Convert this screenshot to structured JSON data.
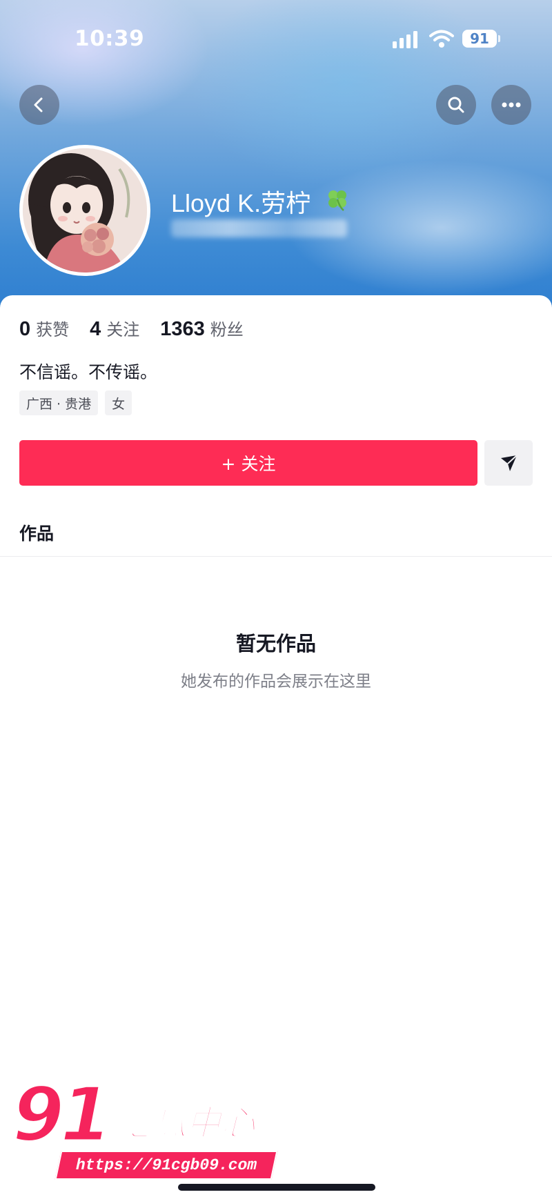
{
  "status_bar": {
    "time": "10:39",
    "battery": "91"
  },
  "profile": {
    "username": "Lloyd K.劳柠",
    "stats": [
      {
        "value": "0",
        "label": "获赞"
      },
      {
        "value": "4",
        "label": "关注"
      },
      {
        "value": "1363",
        "label": "粉丝"
      }
    ],
    "bio": "不信谣。不传谣。",
    "tags": [
      "广西 · 贵港",
      "女"
    ]
  },
  "actions": {
    "follow_label": "+ 关注"
  },
  "tabs": {
    "works": "作品"
  },
  "empty_state": {
    "title": "暂无作品",
    "subtitle": "她发布的作品会展示在这里"
  },
  "watermark": {
    "number": "91",
    "text": "吃瓜中心",
    "url": "https://91cgb09.com"
  },
  "colors": {
    "accent": "#fe2c55",
    "watermark": "#f5245c"
  },
  "icons": [
    "back-icon",
    "search-icon",
    "more-icon",
    "share-icon",
    "clover-icon",
    "signal-icon",
    "wifi-icon"
  ]
}
